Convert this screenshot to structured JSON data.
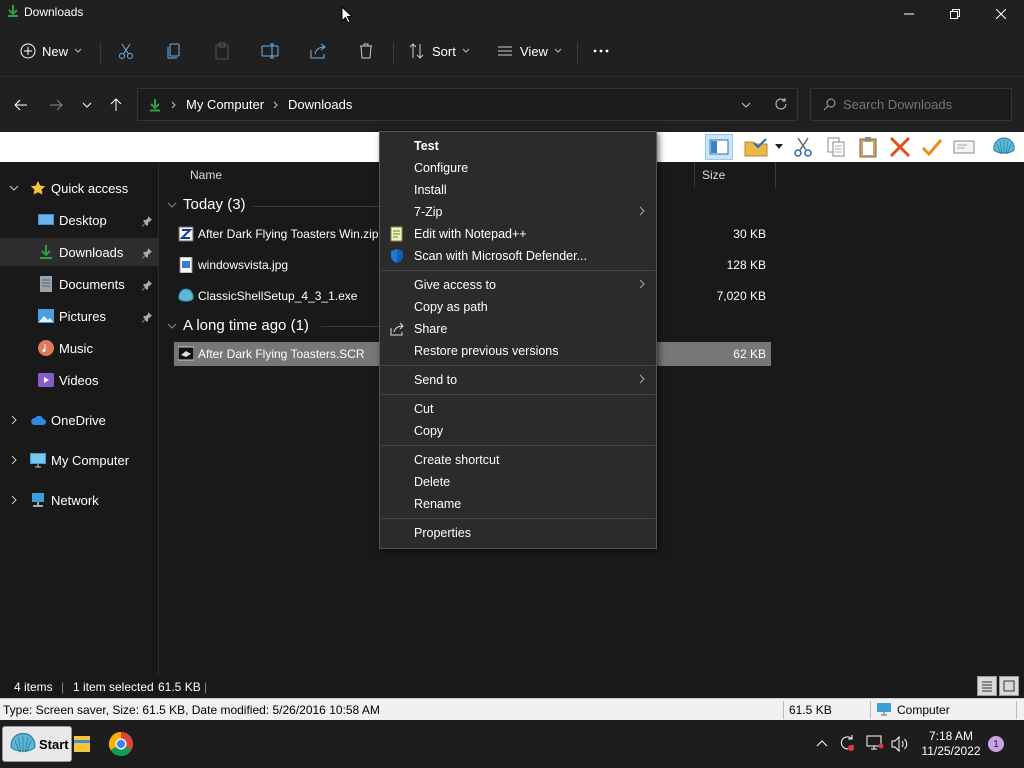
{
  "window": {
    "title": "Downloads"
  },
  "cmdbar": {
    "new_label": "New",
    "sort_label": "Sort",
    "view_label": "View"
  },
  "address": {
    "crumbs": [
      "My Computer",
      "Downloads"
    ],
    "search_placeholder": "Search Downloads"
  },
  "nav": {
    "quick_access": "Quick access",
    "desktop": "Desktop",
    "downloads": "Downloads",
    "documents": "Documents",
    "pictures": "Pictures",
    "music": "Music",
    "videos": "Videos",
    "onedrive": "OneDrive",
    "my_computer": "My Computer",
    "network": "Network"
  },
  "columns": {
    "name": "Name",
    "size": "Size"
  },
  "groups": [
    {
      "label": "Today (3)",
      "files": [
        {
          "name": "After Dark Flying Toasters Win.zip",
          "size": "30 KB",
          "icon": "zip-icon"
        },
        {
          "name": "windowsvista.jpg",
          "size": "128 KB",
          "icon": "image-file-icon"
        },
        {
          "name": "ClassicShellSetup_4_3_1.exe",
          "size": "7,020 KB",
          "icon": "shell-installer-icon"
        }
      ]
    },
    {
      "label": "A long time ago (1)",
      "files": [
        {
          "name": "After Dark Flying Toasters.SCR",
          "size": "62 KB",
          "icon": "screensaver-icon"
        }
      ]
    }
  ],
  "status": {
    "item_count": "4 items",
    "selected": "1 item selected",
    "selected_size": "61.5 KB"
  },
  "classic_status": {
    "details": "Type: Screen saver, Size: 61.5 KB, Date modified: 5/26/2016 10:58 AM",
    "size": "61.5 KB",
    "zone": "Computer"
  },
  "context_menu": {
    "items": [
      {
        "label": "Test",
        "bold": true
      },
      {
        "label": "Configure"
      },
      {
        "label": "Install"
      },
      {
        "label": "7-Zip",
        "submenu": true
      },
      {
        "label": "Edit with Notepad++",
        "icon": "notepadpp-icon"
      },
      {
        "label": "Scan with Microsoft Defender...",
        "icon": "defender-shield-icon"
      },
      {
        "label": "Give access to",
        "submenu": true
      },
      {
        "label": "Copy as path"
      },
      {
        "label": "Share",
        "icon": "share-icon"
      },
      {
        "label": "Restore previous versions"
      },
      {
        "label": "Send to",
        "submenu": true
      },
      {
        "label": "Cut"
      },
      {
        "label": "Copy"
      },
      {
        "label": "Create shortcut"
      },
      {
        "label": "Delete"
      },
      {
        "label": "Rename"
      },
      {
        "label": "Properties"
      }
    ]
  },
  "taskbar": {
    "start_label": "Start",
    "time": "7:18 AM",
    "date": "11/25/2022",
    "notification_count": "1"
  },
  "colors": {
    "accent": "#4cc2ff",
    "selection": "#777777",
    "download_green": "#2ea043"
  }
}
